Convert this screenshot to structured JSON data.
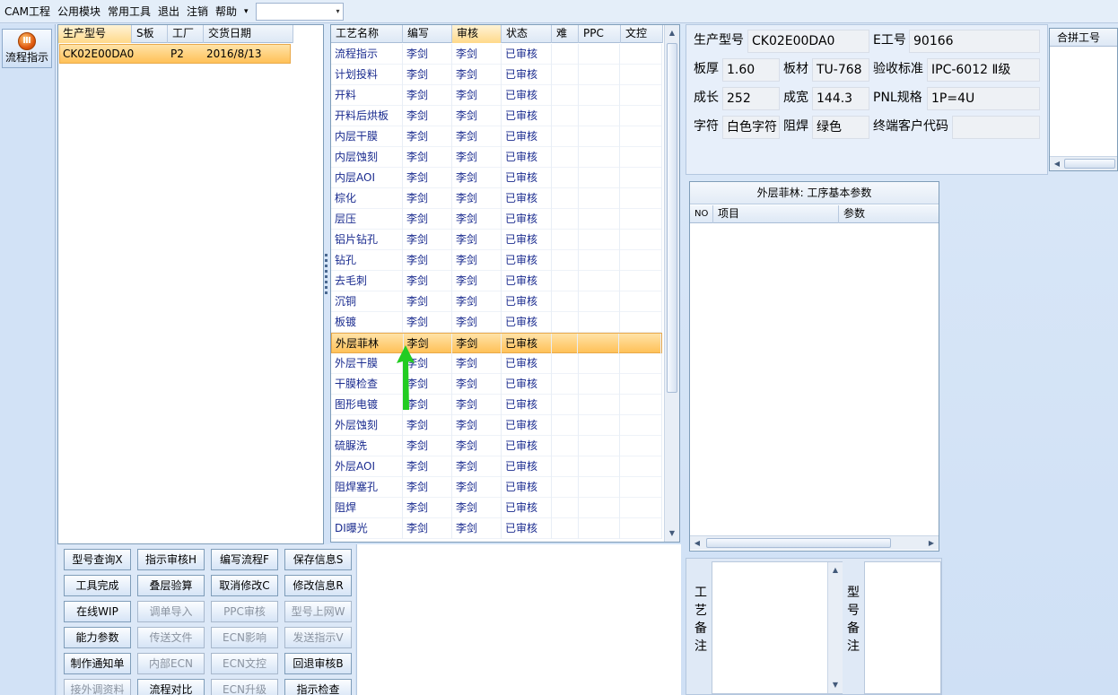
{
  "menu": {
    "items": [
      "CAM工程",
      "公用模块",
      "常用工具",
      "退出",
      "注销",
      "帮助"
    ],
    "dropdown_glyph": "▾"
  },
  "toolbar": {
    "flow_button_label": "流程指示"
  },
  "product_list": {
    "columns": [
      "生产型号",
      "S板",
      "工厂",
      "交货日期"
    ],
    "rows": [
      {
        "model": "CK02E00DA0",
        "s": "",
        "factory": "P2",
        "date": "2016/8/13"
      }
    ]
  },
  "process_list": {
    "columns": [
      "工艺名称",
      "编写",
      "审核",
      "状态",
      "难",
      "PPC",
      "文控"
    ],
    "rows": [
      [
        "流程指示",
        "李剑",
        "李剑",
        "已审核"
      ],
      [
        "计划投料",
        "李剑",
        "李剑",
        "已审核"
      ],
      [
        "开料",
        "李剑",
        "李剑",
        "已审核"
      ],
      [
        "开料后烘板",
        "李剑",
        "李剑",
        "已审核"
      ],
      [
        "内层干膜",
        "李剑",
        "李剑",
        "已审核"
      ],
      [
        "内层蚀刻",
        "李剑",
        "李剑",
        "已审核"
      ],
      [
        "内层AOI",
        "李剑",
        "李剑",
        "已审核"
      ],
      [
        "棕化",
        "李剑",
        "李剑",
        "已审核"
      ],
      [
        "层压",
        "李剑",
        "李剑",
        "已审核"
      ],
      [
        "铝片钻孔",
        "李剑",
        "李剑",
        "已审核"
      ],
      [
        "钻孔",
        "李剑",
        "李剑",
        "已审核"
      ],
      [
        "去毛刺",
        "李剑",
        "李剑",
        "已审核"
      ],
      [
        "沉铜",
        "李剑",
        "李剑",
        "已审核"
      ],
      [
        "板镀",
        "李剑",
        "李剑",
        "已审核"
      ],
      [
        "外层菲林",
        "李剑",
        "李剑",
        "已审核"
      ],
      [
        "外层干膜",
        "李剑",
        "李剑",
        "已审核"
      ],
      [
        "干膜检查",
        "李剑",
        "李剑",
        "已审核"
      ],
      [
        "图形电镀",
        "李剑",
        "李剑",
        "已审核"
      ],
      [
        "外层蚀刻",
        "李剑",
        "李剑",
        "已审核"
      ],
      [
        "硫脲洗",
        "李剑",
        "李剑",
        "已审核"
      ],
      [
        "外层AOI",
        "李剑",
        "李剑",
        "已审核"
      ],
      [
        "阻焊塞孔",
        "李剑",
        "李剑",
        "已审核"
      ],
      [
        "阻焊",
        "李剑",
        "李剑",
        "已审核"
      ],
      [
        "DI曝光",
        "李剑",
        "李剑",
        "已审核"
      ]
    ],
    "selected_index": 14
  },
  "info": {
    "model_label": "生产型号",
    "model": "CK02E00DA0",
    "eno_label": "E工号",
    "eno": "90166",
    "thickness_label": "板厚",
    "thickness": "1.60",
    "material_label": "板材",
    "material": "TU-768",
    "standard_label": "验收标准",
    "standard": "IPC-6012 Ⅱ级",
    "length_label": "成长",
    "length": "252",
    "width_label": "成宽",
    "width": "144.3",
    "pnl_label": "PNL规格",
    "pnl": "1P=4U",
    "char_label": "字符",
    "char": "白色字符",
    "mask_label": "阻焊",
    "mask": "绿色",
    "customer_label": "终端客户代码",
    "customer": ""
  },
  "merge": {
    "header": "合拼工号"
  },
  "params": {
    "title": "外层菲林: 工序基本参数",
    "columns": [
      "NO",
      "项目",
      "参数"
    ]
  },
  "buttons": [
    [
      "型号查询X",
      "指示审核H",
      "编写流程F",
      "保存信息S"
    ],
    [
      "工具完成",
      "叠层验算",
      "取消修改C",
      "修改信息R"
    ],
    [
      "在线WIP",
      "调单导入",
      "PPC审核",
      "型号上网W"
    ],
    [
      "能力参数",
      "传送文件",
      "ECN影响",
      "发送指示V"
    ],
    [
      "制作通知单",
      "内部ECN",
      "ECN文控",
      "回退审核B"
    ],
    [
      "接外调资料",
      "流程对比",
      "ECN升级",
      "指示检查"
    ]
  ],
  "disabled_buttons": [
    "调单导入",
    "PPC审核",
    "型号上网W",
    "传送文件",
    "ECN影响",
    "发送指示V",
    "内部ECN",
    "ECN文控",
    "接外调资料",
    "ECN升级"
  ],
  "remarks": {
    "process_label": "工艺备注",
    "model_label": "型号备注"
  },
  "colors": {
    "accent_select": "#ffc158",
    "arrow": "#22cc22"
  }
}
